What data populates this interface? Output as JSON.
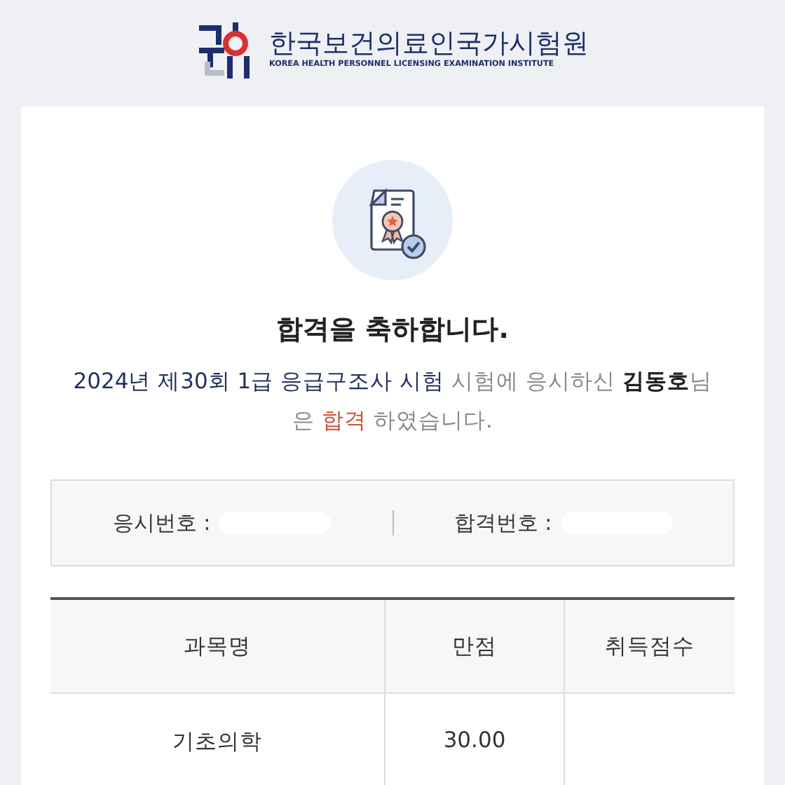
{
  "header": {
    "org_name": "한국보건의료인국가시험원",
    "org_name_en": "KOREA HEALTH PERSONNEL LICENSING EXAMINATION INSTITUTE"
  },
  "result": {
    "title": "합격을 축하합니다.",
    "message": [
      {
        "kind": "exam",
        "text": "2024년 제30회 1급 응급구조사 시험"
      },
      {
        "kind": "plain",
        "text": " 시험에 응시하신 "
      },
      {
        "kind": "name",
        "text": "김동호"
      },
      {
        "kind": "plain",
        "text": "님은 "
      },
      {
        "kind": "result",
        "text": "합격"
      },
      {
        "kind": "plain",
        "text": " 하였습니다."
      }
    ]
  },
  "numbers": [
    {
      "label": "응시번호 :",
      "redacted": true
    },
    {
      "label": "합격번호 :",
      "redacted": true
    }
  ],
  "table": {
    "columns": [
      "과목명",
      "만점",
      "취득점수"
    ],
    "rows": [
      [
        "기초의학",
        "30.00",
        ""
      ]
    ]
  }
}
